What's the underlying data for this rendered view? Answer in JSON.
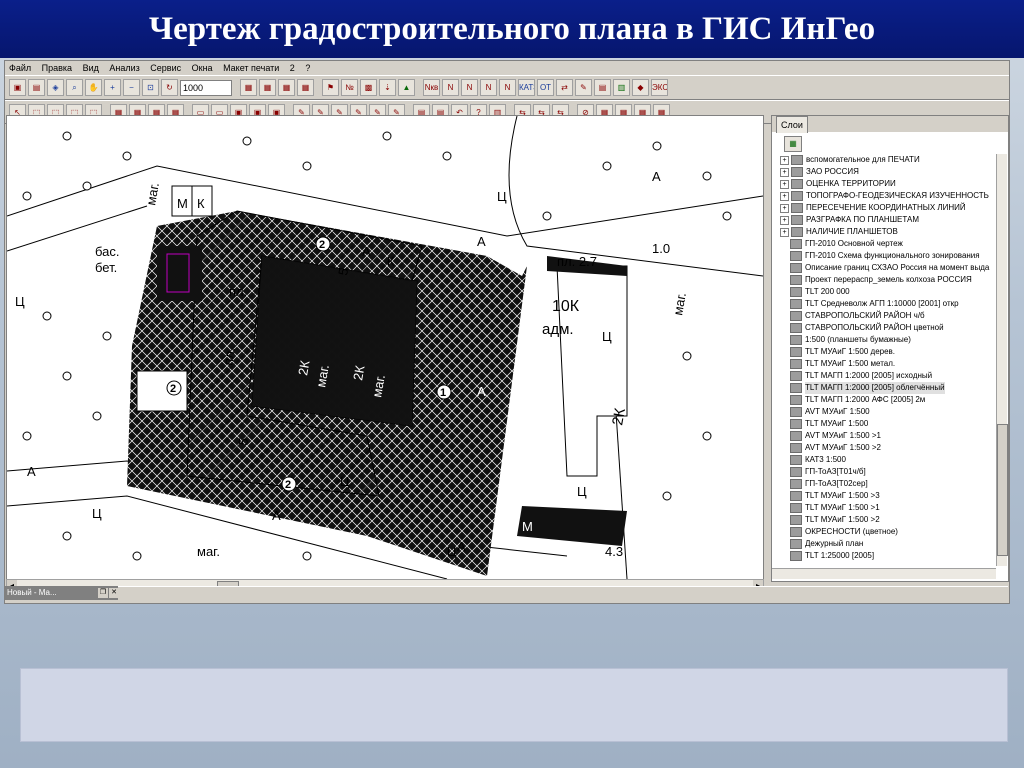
{
  "slide": {
    "title": "Чертеж градостроительного плана в ГИС ИнГео"
  },
  "menu": [
    "Файл",
    "Правка",
    "Вид",
    "Анализ",
    "Сервис",
    "Окна",
    "Макет печати",
    "2",
    "?"
  ],
  "toolbar": {
    "zoom_value": "1000",
    "icons": [
      "Nкв",
      "N",
      "N",
      "N",
      "N",
      "N",
      "КАТЗ",
      "ОТ",
      "ЭКС"
    ]
  },
  "map": {
    "labels": {
      "mag1": "маг.",
      "m1": "М",
      "k1": "К",
      "bas": "бас.",
      "bet": "бет.",
      "pl1": "пл.",
      "pl27": "пл. 2.7",
      "v10": "1.0",
      "k10": "10К",
      "adm": "адм.",
      "mag2": "маг.",
      "k2": "2К",
      "mag3": "маг.",
      "k2b": "2К",
      "mag4": "маг.",
      "k2c": "2К",
      "mag5": "маг.",
      "mag6": "маг.",
      "pl43": "4.3",
      "a1": "А",
      "a2": "А",
      "a3": "А",
      "a4": "А",
      "a5": "А",
      "a6": "А",
      "a7": "А",
      "c1": "Ц",
      "c2": "Ц",
      "c3": "Ц",
      "c4": "Ц",
      "c5": "Ц",
      "c6": "Ц",
      "c7": "Ц",
      "n2a": "2",
      "n2b": "2",
      "n2c": "2",
      "n1": "1",
      "n5a": "5",
      "n5b": "5",
      "kk": "К",
      "m2": "М",
      "pl2": "пл."
    }
  },
  "layers": {
    "tab": "Слои",
    "groups": [
      "вспомогательное для ПЕЧАТИ",
      "ЗАО РОССИЯ",
      "ОЦЕНКА ТЕРРИТОРИИ",
      "ТОПОГРАФО-ГЕОДЕЗИЧЕСКАЯ ИЗУЧЕННОСТЬ",
      "ПЕРЕСЕЧЕНИЕ КООРДИНАТНЫХ ЛИНИЙ",
      "РАЗГРАФКА ПО ПЛАНШЕТАМ",
      "НАЛИЧИЕ ПЛАНШЕТОВ"
    ],
    "items": [
      "ГП-2010 Основной чертеж",
      "ГП-2010 Схема функционального зонирования",
      "Описание границ СХЗАО Россия на момент выда",
      "Проект перераспр_земель колхоза РОССИЯ",
      "TLT 200 000",
      "TLT Средневолж АГП 1:10000 [2001] откр",
      "СТАВРОПОЛЬСКИЙ РАЙОН ч/б",
      "СТАВРОПОЛЬСКИЙ РАЙОН цветной",
      "1:500 (планшеты бумажные)",
      "TLT МУАиГ 1:500 дерев.",
      "TLT МУАиГ 1:500 метал.",
      "TLT МАГП 1:2000 [2005] исходный",
      "TLT МАГП 1:2000 [2005] облегчённый",
      "TLT МАГП 1:2000 АФС [2005] 2м",
      "AVT МУАиГ 1:500",
      "TLT МУАиГ 1:500",
      "AVT МУАиГ 1:500 >1",
      "AVT МУАиГ 1:500 >2",
      "КАТ3 1:500",
      "ГП-ТоАЗ[Т01ч/б]",
      "ГП-ТоАЗ[Т02сер]",
      "TLT МУАиГ 1:500 >3",
      "TLT МУАиГ 1:500 >1",
      "TLT МУАиГ 1:500 >2",
      "ОКРЕСНОСТИ (цветное)",
      "Дежурный план",
      "TLT 1:25000 [2005]"
    ],
    "selected_index": 12
  },
  "window": {
    "task_label": "Новый - Ма..."
  }
}
